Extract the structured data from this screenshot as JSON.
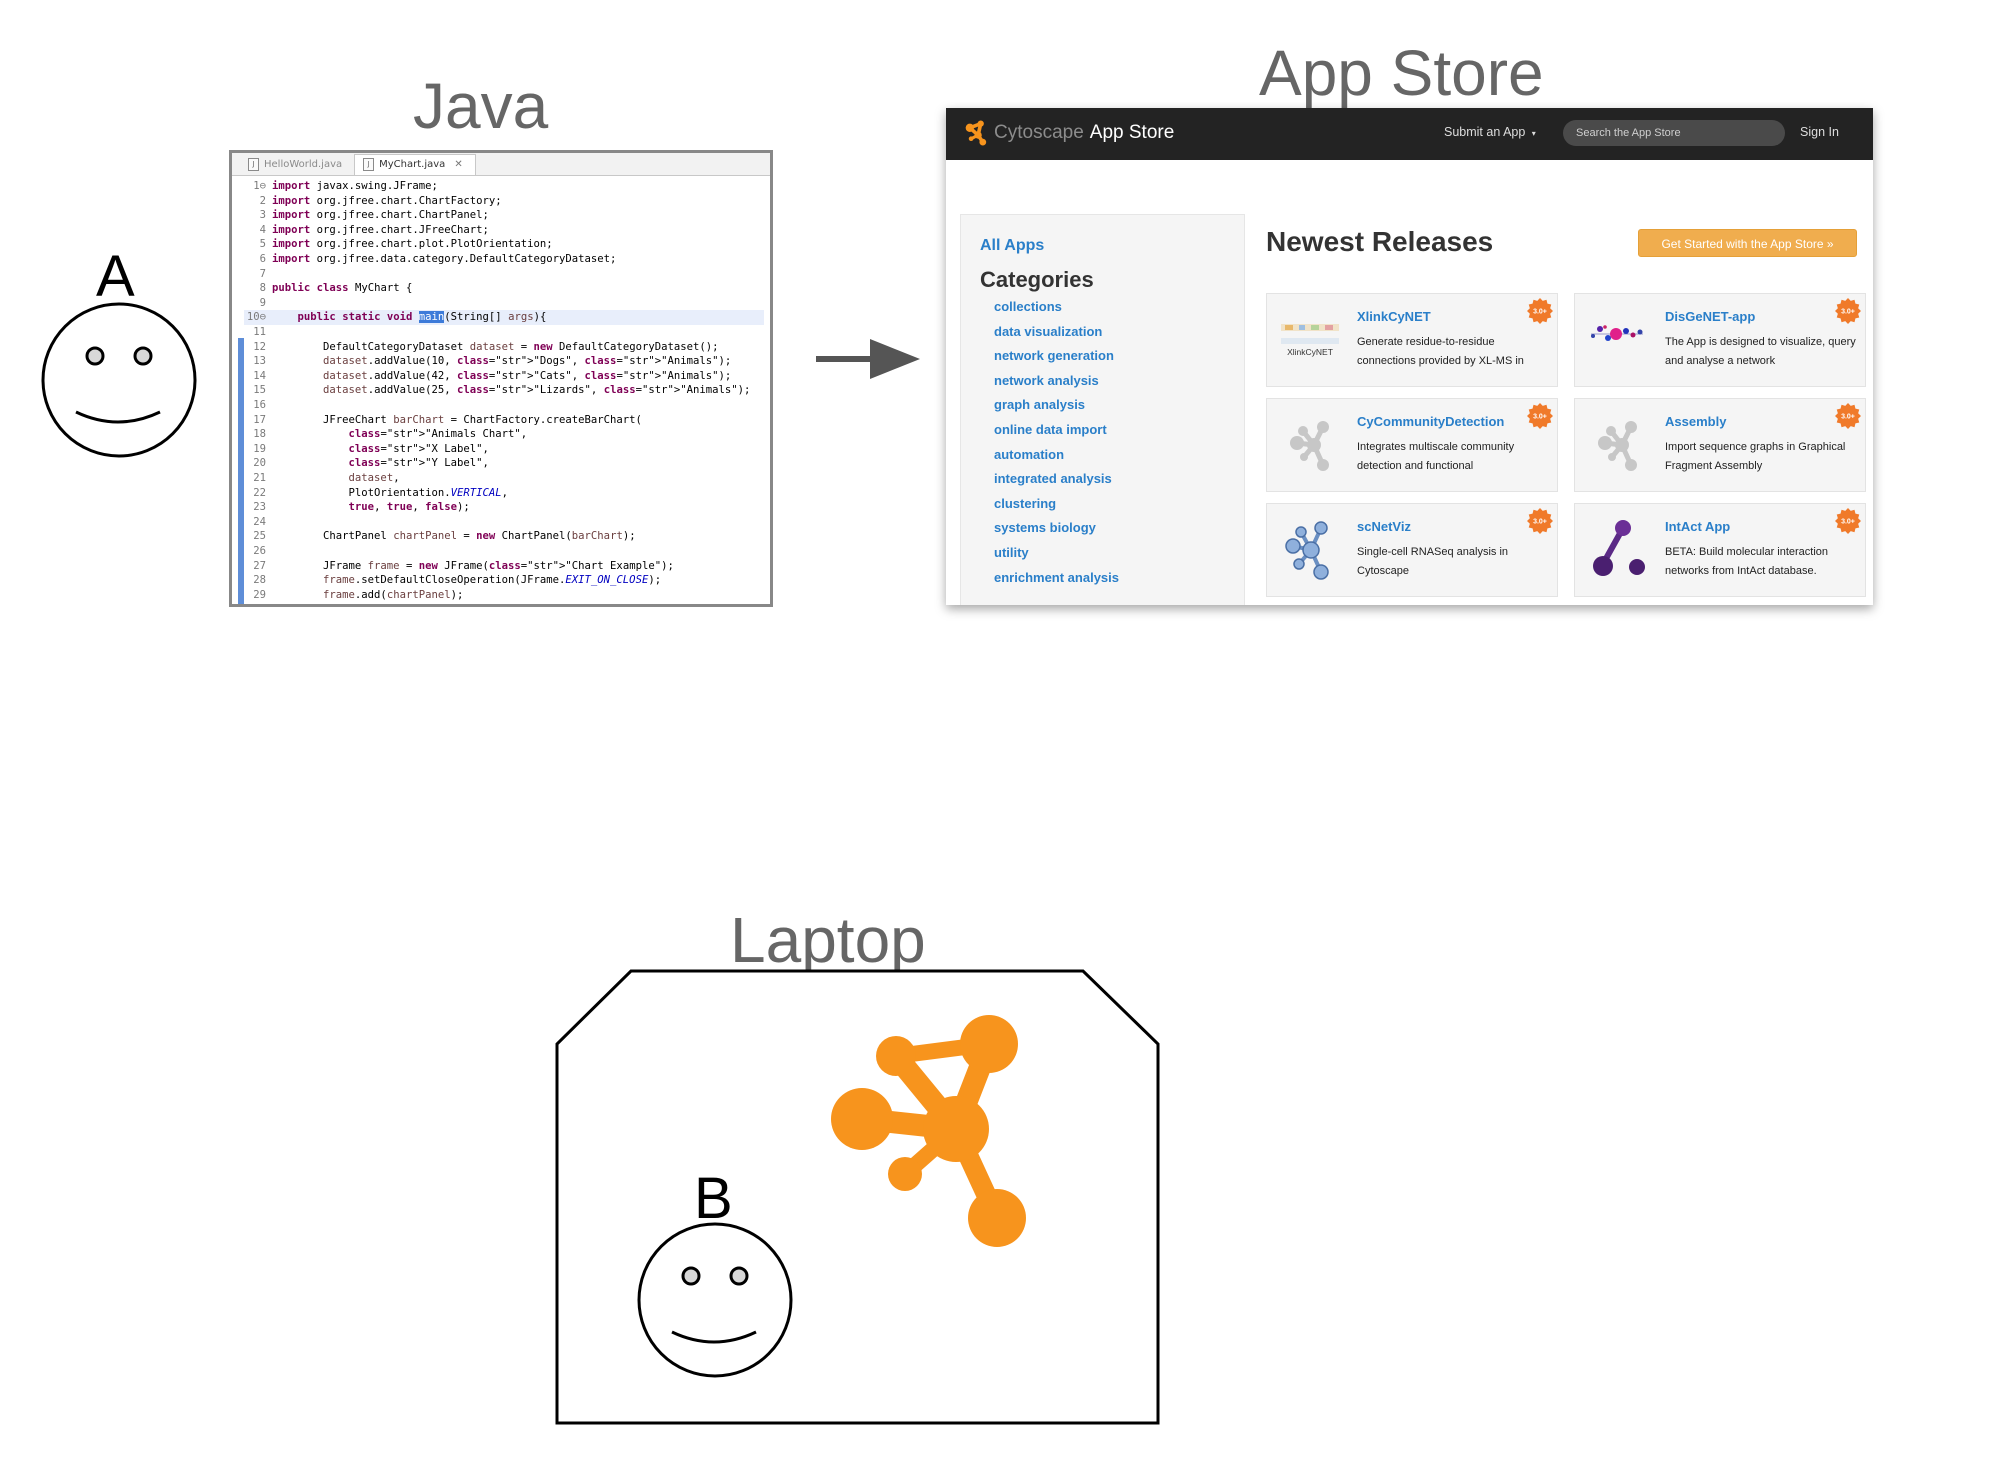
{
  "java": {
    "heading": "Java",
    "tabs": [
      {
        "label": "HelloWorld.java"
      },
      {
        "label": "MyChart.java"
      }
    ],
    "code_lines": [
      {
        "num": "1⊖",
        "text": "import javax.swing.JFrame;"
      },
      {
        "num": "2",
        "text": "import org.jfree.chart.ChartFactory;"
      },
      {
        "num": "3",
        "text": "import org.jfree.chart.ChartPanel;"
      },
      {
        "num": "4",
        "text": "import org.jfree.chart.JFreeChart;"
      },
      {
        "num": "5",
        "text": "import org.jfree.chart.plot.PlotOrientation;"
      },
      {
        "num": "6",
        "text": "import org.jfree.data.category.DefaultCategoryDataset;"
      },
      {
        "num": "7",
        "text": ""
      },
      {
        "num": "8",
        "text": "public class MyChart {"
      },
      {
        "num": "9",
        "text": ""
      },
      {
        "num": "10⊖",
        "text": "    public static void main(String[] args){"
      },
      {
        "num": "11",
        "text": ""
      },
      {
        "num": "12",
        "text": "        DefaultCategoryDataset dataset = new DefaultCategoryDataset();"
      },
      {
        "num": "13",
        "text": "        dataset.addValue(10, \"Dogs\", \"Animals\");"
      },
      {
        "num": "14",
        "text": "        dataset.addValue(42, \"Cats\", \"Animals\");"
      },
      {
        "num": "15",
        "text": "        dataset.addValue(25, \"Lizards\", \"Animals\");"
      },
      {
        "num": "16",
        "text": ""
      },
      {
        "num": "17",
        "text": "        JFreeChart barChart = ChartFactory.createBarChart("
      },
      {
        "num": "18",
        "text": "            \"Animals Chart\","
      },
      {
        "num": "19",
        "text": "            \"X Label\","
      },
      {
        "num": "20",
        "text": "            \"Y Label\","
      },
      {
        "num": "21",
        "text": "            dataset,"
      },
      {
        "num": "22",
        "text": "            PlotOrientation.VERTICAL,"
      },
      {
        "num": "23",
        "text": "            true, true, false);"
      },
      {
        "num": "24",
        "text": ""
      },
      {
        "num": "25",
        "text": "        ChartPanel chartPanel = new ChartPanel(barChart);"
      },
      {
        "num": "26",
        "text": ""
      },
      {
        "num": "27",
        "text": "        JFrame frame = new JFrame(\"Chart Example\");"
      },
      {
        "num": "28",
        "text": "        frame.setDefaultCloseOperation(JFrame.EXIT_ON_CLOSE);"
      },
      {
        "num": "29",
        "text": "        frame.add(chartPanel);"
      }
    ]
  },
  "app_store": {
    "heading": "App Store",
    "brand_prefix": "Cytoscape",
    "brand_suffix": "App Store",
    "nav_submit": "Submit an App",
    "search_placeholder": "Search the App Store",
    "nav_signin": "Sign In",
    "all_apps": "All Apps",
    "categories_title": "Categories",
    "categories": [
      "collections",
      "data visualization",
      "network generation",
      "network analysis",
      "graph analysis",
      "online data import",
      "automation",
      "integrated analysis",
      "clustering",
      "systems biology",
      "utility",
      "enrichment analysis"
    ],
    "releases_title": "Newest Releases",
    "get_started": "Get Started with the App Store »",
    "badge": "3.0+",
    "apps": [
      {
        "title": "XlinkCyNET",
        "desc": "Generate residue-to-residue connections provided by XL-MS in",
        "icon": "xlinkcynet-logo",
        "icon_text": "XlinkCyNET"
      },
      {
        "title": "DisGeNET-app",
        "desc": "The App is designed to visualize, query and analyse a network",
        "icon": "disgenet-logo"
      },
      {
        "title": "CyCommunityDetection",
        "desc": "Integrates multiscale community detection and functional",
        "icon": "generic-app-icon"
      },
      {
        "title": "Assembly",
        "desc": "Import sequence graphs in Graphical Fragment Assembly",
        "icon": "generic-app-icon"
      },
      {
        "title": "scNetViz",
        "desc": "Single-cell RNASeq analysis in Cytoscape",
        "icon": "scnetviz-logo"
      },
      {
        "title": "IntAct App",
        "desc": "BETA: Build molecular interaction networks from IntAct database.",
        "icon": "intact-logo"
      }
    ]
  },
  "laptop": {
    "heading": "Laptop"
  },
  "users": {
    "a_label": "A",
    "b_label": "B"
  },
  "colors": {
    "cytoscape_orange": "#f7941d",
    "link_blue": "#2a7fc9",
    "nav_dark": "#232323",
    "label_gray": "#666666"
  }
}
